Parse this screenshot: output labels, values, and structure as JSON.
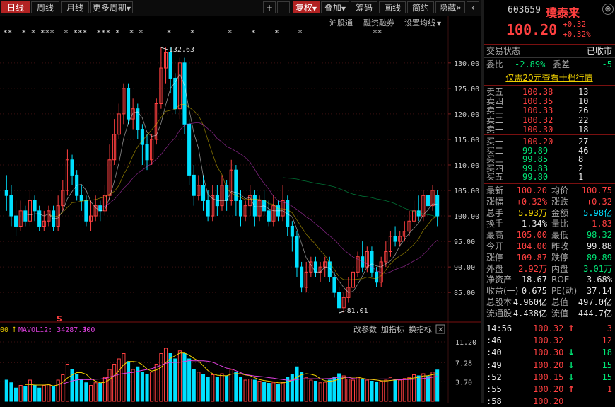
{
  "toolbar": {
    "tabs": [
      "日线",
      "周线",
      "月线",
      "更多周期"
    ],
    "active_tab": 0,
    "more_period_label": "更多周期",
    "plus": "+",
    "minus": "—",
    "fq_label": "复权",
    "overlay_label": "叠加",
    "chips_label": "筹码",
    "draw_label": "画线",
    "simple_label": "简约",
    "hide_label": "隐藏",
    "expand": "»"
  },
  "chart_links": {
    "hgt": "沪股通",
    "rzrq": "融资融券",
    "ma_settings": "设置均线"
  },
  "marker_row": "**  * * ***  * ***  *** *  * *     *    *       *    *    *    *               **",
  "s_marker": "S",
  "volume_bar": {
    "left_label": "00",
    "mavol": "MAVOL12: 34287.000",
    "arrow": "↑",
    "buttons": [
      "改参数",
      "加指标",
      "换指标"
    ],
    "close": "✕"
  },
  "colors": {
    "up": "#ff4040",
    "down": "#00e0ff",
    "ma_white": "#ffffff",
    "ma_yellow": "#f0d000",
    "ma_magenta": "#e040e0",
    "ma_green": "#00d060"
  },
  "chart_data": {
    "type": "candlestick",
    "y_ticks": [
      "130.00",
      "125.00",
      "120.00",
      "115.00",
      "110.00",
      "105.00",
      "100.00",
      "95.00",
      "90.00",
      "85.00"
    ],
    "ylim": [
      81,
      134
    ],
    "high_annotation": "132.63",
    "low_annotation": "81.01",
    "vol_ticks": [
      "11.20",
      "7.28",
      "3.70"
    ],
    "vol_ylim": [
      0,
      12
    ],
    "candles": [
      [
        105,
        104,
        108,
        101
      ],
      [
        104,
        100,
        106,
        98
      ],
      [
        100,
        98,
        103,
        96
      ],
      [
        98,
        101,
        103,
        97
      ],
      [
        101,
        99,
        102,
        98
      ],
      [
        99,
        103,
        105,
        98
      ],
      [
        103,
        101,
        104,
        99
      ],
      [
        101,
        98,
        102,
        97
      ],
      [
        98,
        99,
        101,
        97
      ],
      [
        99,
        101,
        102,
        98
      ],
      [
        101,
        98,
        102,
        97
      ],
      [
        98,
        102,
        104,
        97
      ],
      [
        102,
        105,
        107,
        101
      ],
      [
        105,
        111,
        113,
        104
      ],
      [
        111,
        108,
        112,
        106
      ],
      [
        108,
        104,
        109,
        103
      ],
      [
        104,
        103,
        106,
        101
      ],
      [
        103,
        99,
        104,
        98
      ],
      [
        99,
        100,
        103,
        97
      ],
      [
        100,
        102,
        104,
        99
      ],
      [
        102,
        101,
        103,
        99
      ],
      [
        101,
        104,
        106,
        100
      ],
      [
        104,
        111,
        114,
        103
      ],
      [
        111,
        116,
        119,
        110
      ],
      [
        116,
        120,
        122,
        115
      ],
      [
        120,
        125,
        126,
        118
      ],
      [
        125,
        119,
        126,
        118
      ],
      [
        119,
        121,
        123,
        117
      ],
      [
        121,
        117,
        122,
        115
      ],
      [
        117,
        114,
        118,
        110
      ],
      [
        114,
        111,
        116,
        109
      ],
      [
        111,
        115,
        116,
        110
      ],
      [
        115,
        122,
        123,
        114
      ],
      [
        122,
        129,
        133,
        121
      ],
      [
        129,
        132,
        133,
        126
      ],
      [
        132,
        127,
        133,
        124
      ],
      [
        127,
        121,
        128,
        120
      ],
      [
        121,
        130,
        131,
        119
      ],
      [
        130,
        118,
        131,
        116
      ],
      [
        118,
        108,
        119,
        106
      ],
      [
        108,
        104,
        110,
        102
      ],
      [
        104,
        106,
        108,
        103
      ],
      [
        106,
        103,
        108,
        101
      ],
      [
        103,
        100,
        105,
        99
      ],
      [
        100,
        104,
        106,
        99
      ],
      [
        104,
        102,
        106,
        100
      ],
      [
        102,
        106,
        108,
        101
      ],
      [
        106,
        103,
        107,
        101
      ],
      [
        103,
        109,
        111,
        102
      ],
      [
        109,
        103,
        110,
        100
      ],
      [
        103,
        100,
        105,
        98
      ],
      [
        100,
        102,
        103,
        99
      ],
      [
        102,
        104,
        106,
        100
      ],
      [
        104,
        100,
        105,
        98
      ],
      [
        100,
        103,
        104,
        99
      ],
      [
        103,
        101,
        105,
        100
      ],
      [
        101,
        99,
        103,
        98
      ],
      [
        99,
        102,
        104,
        98
      ],
      [
        102,
        100,
        103,
        99
      ],
      [
        100,
        103,
        106,
        99
      ],
      [
        103,
        98,
        104,
        96
      ],
      [
        98,
        96,
        99,
        93
      ],
      [
        96,
        90,
        97,
        88
      ],
      [
        90,
        86,
        91,
        85
      ],
      [
        86,
        89,
        91,
        85
      ],
      [
        89,
        91,
        92,
        88
      ],
      [
        91,
        89,
        92,
        88
      ],
      [
        89,
        90,
        91,
        87
      ],
      [
        90,
        91,
        92,
        88
      ],
      [
        91,
        88,
        92,
        87
      ],
      [
        88,
        85,
        89,
        84
      ],
      [
        85,
        82,
        86,
        81
      ],
      [
        82,
        84,
        85,
        81
      ],
      [
        84,
        86,
        88,
        83
      ],
      [
        86,
        89,
        90,
        85
      ],
      [
        89,
        92,
        93,
        88
      ],
      [
        92,
        90,
        95,
        89
      ],
      [
        90,
        93,
        94,
        89
      ],
      [
        93,
        89,
        94,
        88
      ],
      [
        89,
        87,
        90,
        86
      ],
      [
        87,
        91,
        92,
        86
      ],
      [
        91,
        93,
        95,
        90
      ],
      [
        93,
        96,
        97,
        92
      ],
      [
        96,
        95,
        98,
        94
      ],
      [
        95,
        96,
        97,
        94
      ],
      [
        96,
        97,
        99,
        95
      ],
      [
        97,
        99,
        101,
        96
      ],
      [
        99,
        101,
        103,
        98
      ],
      [
        101,
        100,
        104,
        99
      ],
      [
        100,
        104,
        105,
        99
      ],
      [
        104,
        102,
        104,
        100
      ],
      [
        102,
        105,
        106,
        101
      ],
      [
        104,
        100,
        105,
        98
      ]
    ],
    "volumes": [
      4,
      3.5,
      2.5,
      3,
      2.8,
      4,
      3,
      2.5,
      3,
      3.2,
      2.8,
      4,
      5,
      7,
      6,
      5,
      4,
      3.5,
      3,
      3.5,
      3.4,
      4.5,
      6,
      7,
      8,
      9,
      7.5,
      6,
      6.5,
      5.5,
      5,
      5.5,
      7,
      9,
      10,
      9,
      8,
      9.5,
      9,
      8,
      6,
      5.5,
      5,
      4.5,
      5,
      4.6,
      5.2,
      4.8,
      6,
      5.5,
      4.5,
      4,
      4.2,
      4,
      3.8,
      3.6,
      3.4,
      3.5,
      3.2,
      3.6,
      4.5,
      5,
      6.5,
      5.5,
      4.5,
      4,
      3.8,
      3.5,
      3.6,
      4,
      4.5,
      5.2,
      4.8,
      4.2,
      4,
      4.5,
      4.2,
      4,
      3.8,
      3.6,
      3.8,
      4,
      4.5,
      4.2,
      4,
      4.3,
      4.5,
      5,
      4.8,
      5.2,
      4.7,
      5.5,
      5.9
    ]
  },
  "quote": {
    "code": "603659",
    "name": "璞泰来",
    "price": "100.20",
    "change": "+0.32",
    "change_pct": "+0.32%",
    "status_label": "交易状态",
    "status_value": "已收市",
    "wb_label": "委比",
    "wb_value": "-2.89%",
    "wc_label": "委差",
    "wc_value": "-5",
    "promo": "仅需20元查看十档行情",
    "asks": [
      {
        "label": "卖五",
        "price": "100.38",
        "vol": "13"
      },
      {
        "label": "卖四",
        "price": "100.35",
        "vol": "10"
      },
      {
        "label": "卖三",
        "price": "100.33",
        "vol": "26"
      },
      {
        "label": "卖二",
        "price": "100.32",
        "vol": "22"
      },
      {
        "label": "卖一",
        "price": "100.30",
        "vol": "18"
      }
    ],
    "bids": [
      {
        "label": "买一",
        "price": "100.20",
        "vol": "27"
      },
      {
        "label": "买二",
        "price": "99.89",
        "vol": "46"
      },
      {
        "label": "买三",
        "price": "99.85",
        "vol": "8"
      },
      {
        "label": "买四",
        "price": "99.83",
        "vol": "2"
      },
      {
        "label": "买五",
        "price": "99.80",
        "vol": "1"
      }
    ],
    "stats": [
      {
        "l1": "最新",
        "v1": "100.20",
        "c1": "red",
        "l2": "均价",
        "v2": "100.75",
        "c2": "red"
      },
      {
        "l1": "涨幅",
        "v1": "+0.32%",
        "c1": "red",
        "l2": "涨跌",
        "v2": "+0.32",
        "c2": "red"
      },
      {
        "l1": "总手",
        "v1": "5.93万",
        "c1": "yellow",
        "l2": "金额",
        "v2": "5.98亿",
        "c2": "cyan"
      },
      {
        "l1": "换手",
        "v1": "1.34%",
        "c1": "white",
        "l2": "量比",
        "v2": "1.83",
        "c2": "red"
      },
      {
        "l1": "最高",
        "v1": "105.00",
        "c1": "red",
        "l2": "最低",
        "v2": "98.32",
        "c2": "green"
      },
      {
        "l1": "今开",
        "v1": "104.00",
        "c1": "red",
        "l2": "昨收",
        "v2": "99.88",
        "c2": "white"
      },
      {
        "l1": "涨停",
        "v1": "109.87",
        "c1": "red",
        "l2": "跌停",
        "v2": "89.89",
        "c2": "green"
      },
      {
        "l1": "外盘",
        "v1": "2.92万",
        "c1": "red",
        "l2": "内盘",
        "v2": "3.01万",
        "c2": "green"
      },
      {
        "l1": "净资产",
        "v1": "18.67",
        "c1": "white",
        "l2": "ROE",
        "v2": "3.68%",
        "c2": "white"
      },
      {
        "l1": "收益(一)",
        "v1": "0.675",
        "c1": "white",
        "l2": "PE(动)",
        "v2": "37.14",
        "c2": "white"
      },
      {
        "l1": "总股本",
        "v1": "4.960亿",
        "c1": "white",
        "l2": "总值",
        "v2": "497.0亿",
        "c2": "white"
      },
      {
        "l1": "流通股",
        "v1": "4.438亿",
        "c1": "white",
        "l2": "流值",
        "v2": "444.7亿",
        "c2": "white"
      }
    ],
    "ticks": [
      {
        "time": "14:56",
        "price": "100.32",
        "dir": "↑",
        "vol": "3"
      },
      {
        "time": ":46",
        "price": "100.32",
        "dir": "",
        "vol": "12"
      },
      {
        "time": ":40",
        "price": "100.30",
        "dir": "↓",
        "vol": "18"
      },
      {
        "time": ":49",
        "price": "100.20",
        "dir": "↓",
        "vol": "15"
      },
      {
        "time": ":52",
        "price": "100.15",
        "dir": "↓",
        "vol": "15"
      },
      {
        "time": ":55",
        "price": "100.20",
        "dir": "↑",
        "vol": "1"
      },
      {
        "time": ":58",
        "price": "100.20",
        "dir": "",
        "vol": ""
      }
    ]
  }
}
